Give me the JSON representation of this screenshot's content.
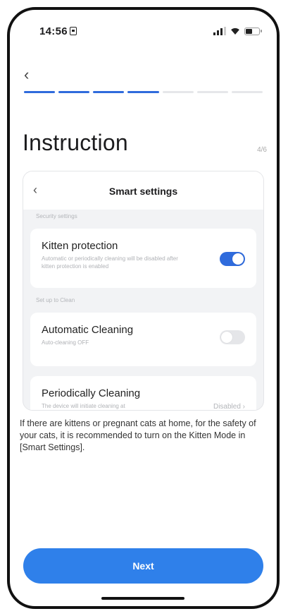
{
  "status_bar": {
    "time": "14:56"
  },
  "header": {
    "title": "Instruction",
    "step": "4/6",
    "progress": {
      "total": 7,
      "completed": 4
    }
  },
  "card": {
    "title": "Smart settings",
    "section1_label": "Security settings",
    "kitten": {
      "title": "Kitten protection",
      "desc": "Automatic or periodically cleaning will be disabled after kitten protection is enabled",
      "enabled": true
    },
    "section2_label": "Set up to Clean",
    "auto": {
      "title": "Automatic Cleaning",
      "desc": "Auto-cleaning OFF",
      "enabled": false
    },
    "periodic": {
      "title": "Periodically Cleaning",
      "desc": "The device will initiate cleaning at",
      "status": "Disabled"
    }
  },
  "instruction_text": "If there are kittens or pregnant cats at home, for the safety of your cats, it is recommended to turn on the Kitten Mode in [Smart Settings].",
  "next_label": "Next",
  "colors": {
    "accent": "#2f6bdc",
    "button": "#2f80ea"
  }
}
